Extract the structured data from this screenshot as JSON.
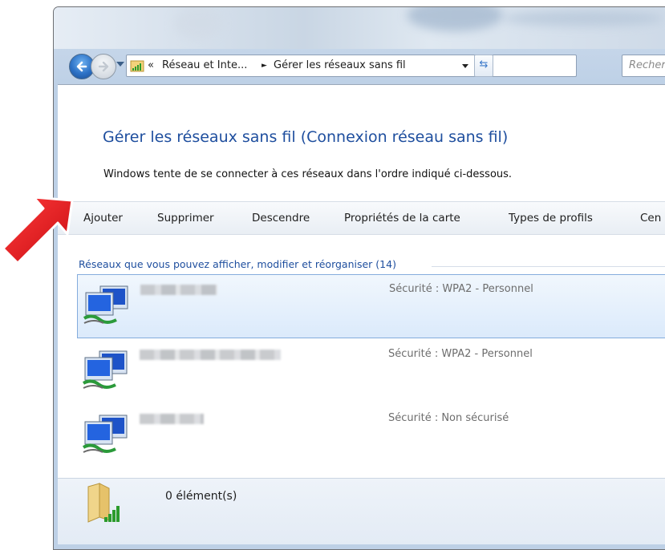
{
  "navigation": {
    "breadcrumb_prefix": "«",
    "breadcrumb_parent": "Réseau et Inte...",
    "breadcrumb_separator": "►",
    "breadcrumb_current": "Gérer les réseaux sans fil",
    "search_placeholder": "Recher"
  },
  "header": {
    "title": "Gérer les réseaux sans fil (Connexion réseau sans fil)",
    "description": "Windows tente de se connecter à ces réseaux dans l'ordre indiqué ci-dessous."
  },
  "toolbar": {
    "items": [
      "Ajouter",
      "Supprimer",
      "Descendre",
      "Propriétés de la carte",
      "Types de profils",
      "Cen"
    ]
  },
  "group": {
    "label": "Réseaux que vous pouvez afficher, modifier et réorganiser (14)"
  },
  "networks": [
    {
      "security": "Sécurité : WPA2 - Personnel",
      "selected": true
    },
    {
      "security": "Sécurité : WPA2 - Personnel",
      "selected": false
    },
    {
      "security": "Sécurité : Non sécurisé",
      "selected": false
    }
  ],
  "details": {
    "count": "0 élément(s)"
  },
  "colors": {
    "title_blue": "#1e4e9e",
    "selection": "#dbeafb",
    "annotation_arrow": "#e0161b"
  },
  "icons": {
    "back": "back-arrow-icon",
    "forward": "forward-arrow-icon",
    "address_icon": "network-signal-icon",
    "refresh": "refresh-icon",
    "network_item": "network-computers-icon",
    "details": "folder-signal-icon",
    "annotation": "red-arrow-icon"
  }
}
